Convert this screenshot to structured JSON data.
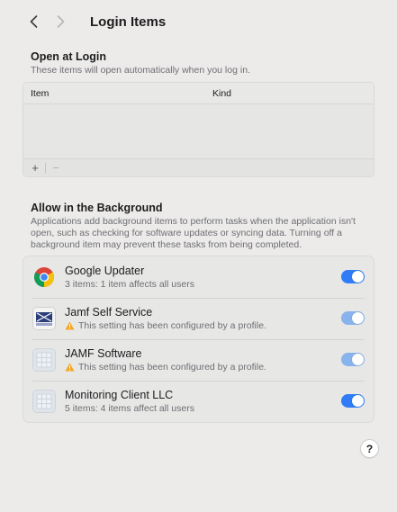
{
  "toolbar": {
    "back_icon": "chevron-left-icon",
    "forward_icon": "chevron-right-icon",
    "title": "Login Items"
  },
  "open_at_login": {
    "title": "Open at Login",
    "subtitle": "These items will open automatically when you log in.",
    "columns": {
      "item": "Item",
      "kind": "Kind"
    },
    "add_label": "+",
    "remove_label": "−"
  },
  "background": {
    "title": "Allow in the Background",
    "description_lines": [
      "Applications add background items to perform tasks when the application isn't",
      "open, such as checking for software updates or syncing data. Turning off a",
      "background item may prevent these tasks from being completed."
    ],
    "items": [
      {
        "name": "Google Updater",
        "detail": "3 items: 1 item affects all users",
        "icon": "chrome-icon",
        "enabled": true,
        "managed": false
      },
      {
        "name": "Jamf Self Service",
        "detail": "This setting has been configured by a profile.",
        "icon": "jamf-self-service-icon",
        "enabled": true,
        "managed": true
      },
      {
        "name": "JAMF Software",
        "detail": "This setting has been configured by a profile.",
        "icon": "generic-app-icon",
        "enabled": true,
        "managed": true
      },
      {
        "name": "Monitoring Client LLC",
        "detail": "5 items: 4 items affect all users",
        "icon": "generic-app-icon",
        "enabled": true,
        "managed": false
      }
    ]
  },
  "help": {
    "label": "?"
  },
  "colors": {
    "accent": "#2f7cf6",
    "accent_disabled": "#89b3ec",
    "warning": "#f5a623",
    "background": "#ecebea"
  }
}
